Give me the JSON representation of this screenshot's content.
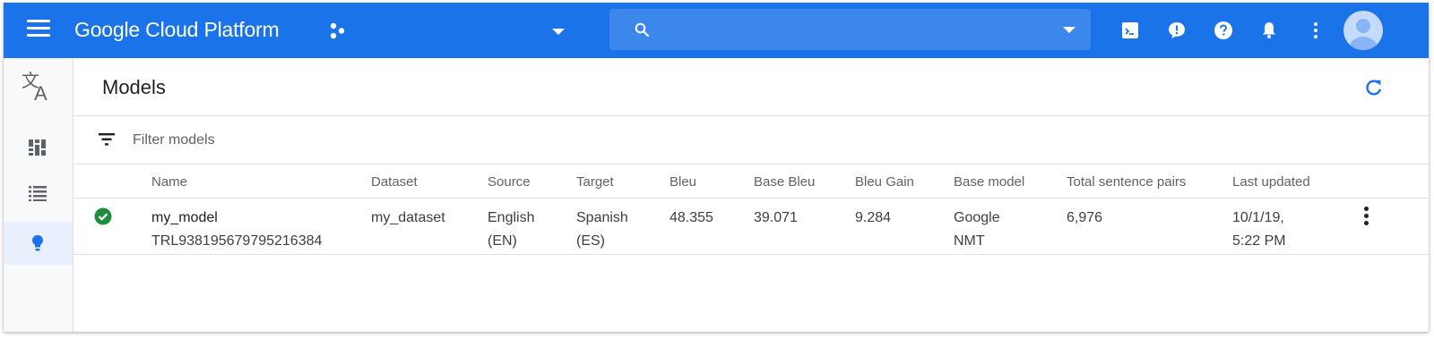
{
  "topbar": {
    "brand": "Google Cloud Platform",
    "search": {
      "placeholder": ""
    },
    "icons": [
      "menu-icon",
      "project-icon",
      "search-icon",
      "cloud-shell-icon",
      "feedback-icon",
      "help-icon",
      "notifications-icon",
      "more-vert-icon",
      "account-avatar"
    ]
  },
  "leftnav": {
    "product_icon": "translate-icon",
    "items": [
      {
        "name": "dashboard-icon",
        "active": false
      },
      {
        "name": "list-icon",
        "active": false
      },
      {
        "name": "lightbulb-icon",
        "active": true
      }
    ]
  },
  "page": {
    "title": "Models",
    "filter": {
      "placeholder": "Filter models"
    }
  },
  "table": {
    "columns": [
      "Name",
      "Dataset",
      "Source",
      "Target",
      "Bleu",
      "Base Bleu",
      "Bleu Gain",
      "Base model",
      "Total sentence pairs",
      "Last updated"
    ],
    "rows": [
      {
        "status": "success",
        "name": "my_model",
        "id": "TRL938195679795216384",
        "dataset": "my_dataset",
        "source_line1": "English",
        "source_line2": "(EN)",
        "target_line1": "Spanish",
        "target_line2": "(ES)",
        "bleu": "48.355",
        "base_bleu": "39.071",
        "bleu_gain": "9.284",
        "base_model_line1": "Google",
        "base_model_line2": "NMT",
        "total_pairs": "6,976",
        "updated_line1": "10/1/19,",
        "updated_line2": "5:22 PM"
      }
    ]
  },
  "colors": {
    "brand_blue": "#1a73e8",
    "success_green": "#1e8e3e",
    "active_nav": "#e8f0fe"
  }
}
